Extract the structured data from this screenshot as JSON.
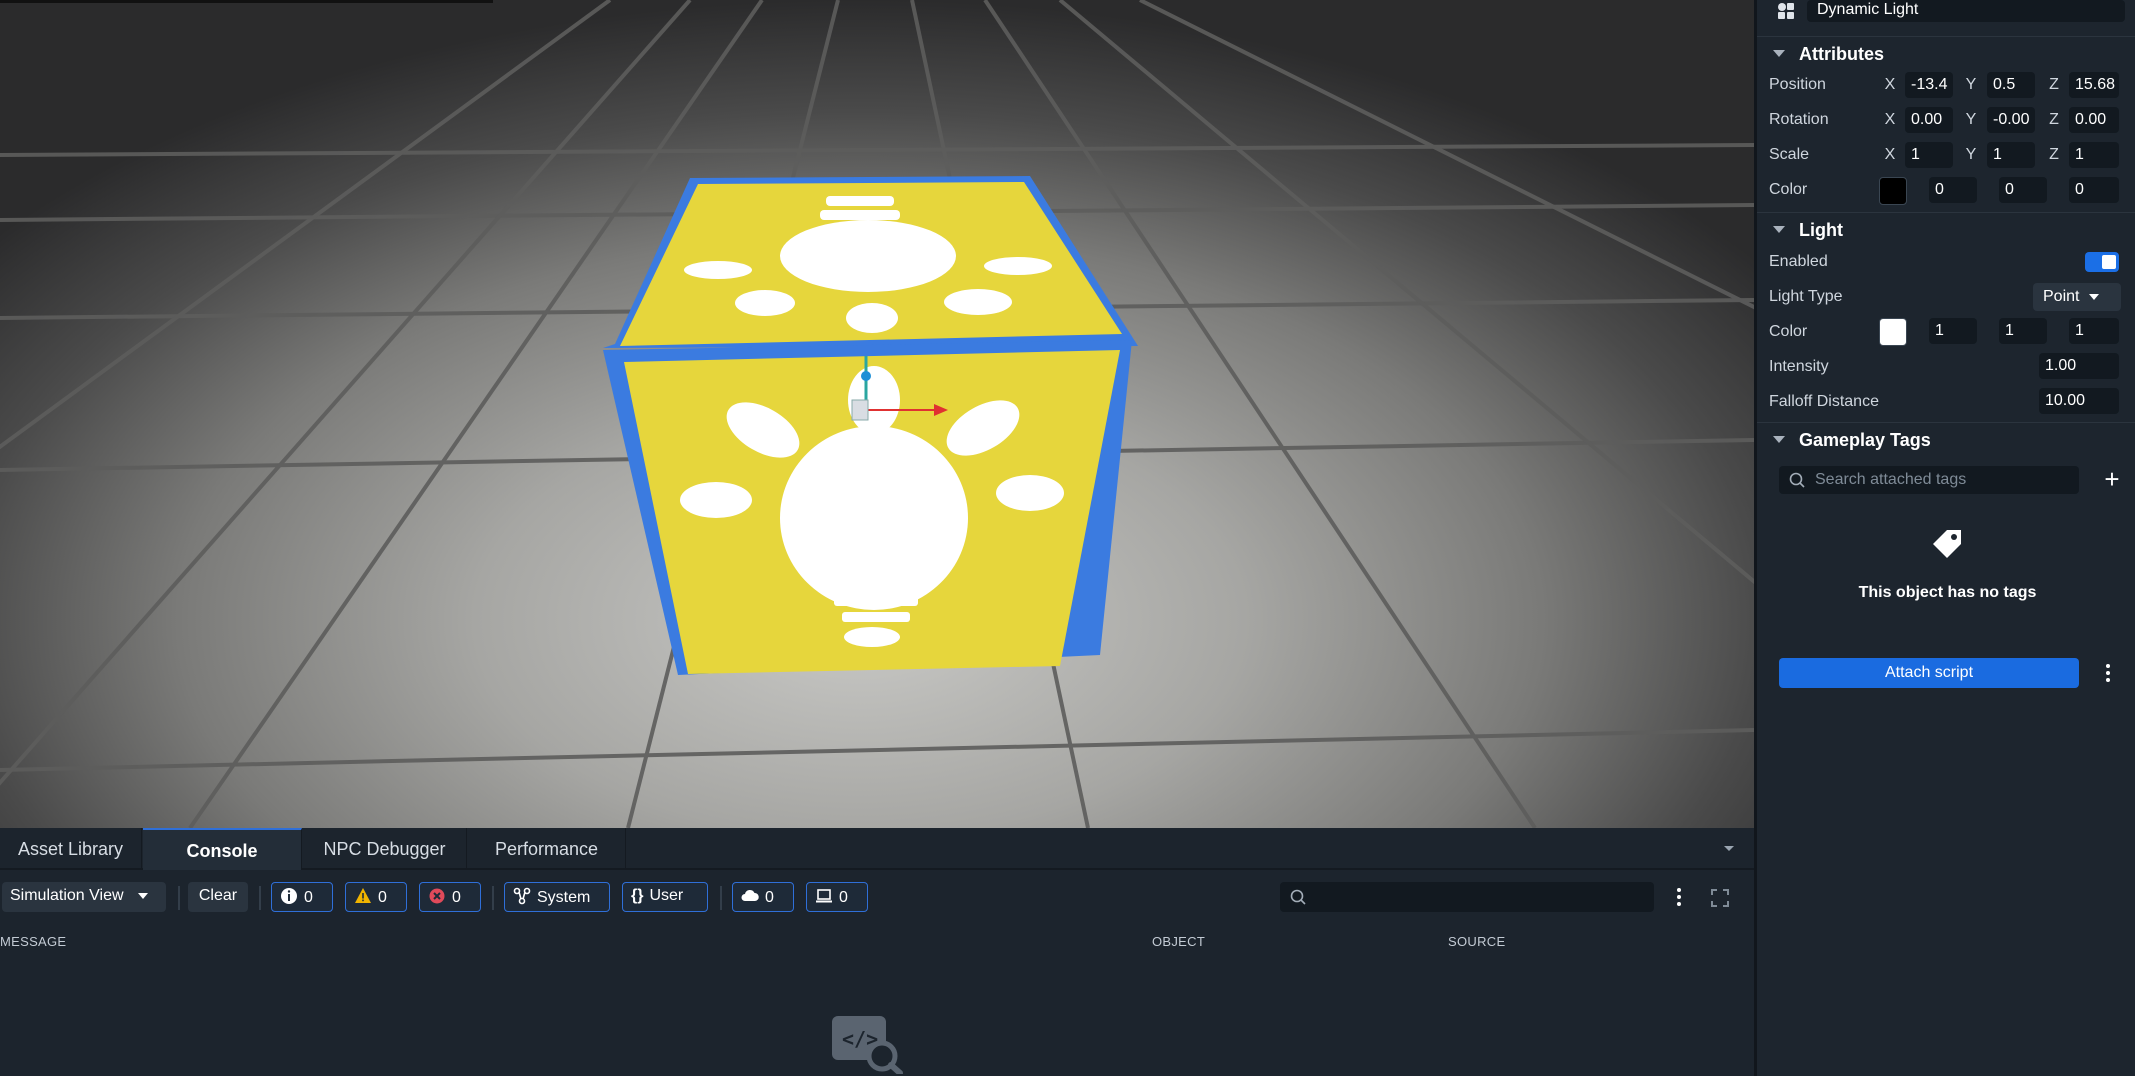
{
  "object": {
    "name": "Dynamic Light"
  },
  "attributes": {
    "title": "Attributes",
    "position": {
      "label": "Position",
      "x": "-13.4",
      "y": "0.5",
      "z": "15.68"
    },
    "rotation": {
      "label": "Rotation",
      "x": "0.00",
      "y": "-0.00",
      "z": "0.00"
    },
    "scale": {
      "label": "Scale",
      "x": "1",
      "y": "1",
      "z": "1"
    },
    "color": {
      "label": "Color",
      "swatch": "#000000",
      "r": "0",
      "g": "0",
      "b": "0"
    },
    "axes": {
      "x": "X",
      "y": "Y",
      "z": "Z"
    }
  },
  "light": {
    "title": "Light",
    "enabled_label": "Enabled",
    "enabled": true,
    "type_label": "Light Type",
    "type_value": "Point",
    "color_label": "Color",
    "color_swatch": "#ffffff",
    "r": "1",
    "g": "1",
    "b": "1",
    "intensity_label": "Intensity",
    "intensity": "1.00",
    "falloff_label": "Falloff Distance",
    "falloff": "10.00"
  },
  "tags": {
    "title": "Gameplay Tags",
    "search_placeholder": "Search attached tags",
    "add_symbol": "+",
    "empty_text": "This object has no tags"
  },
  "actions": {
    "attach_script": "Attach script"
  },
  "dock": {
    "tabs": [
      {
        "label": "Asset Library"
      },
      {
        "label": "Console",
        "active": true
      },
      {
        "label": "NPC Debugger"
      },
      {
        "label": "Performance"
      }
    ],
    "toolbar": {
      "view_select": "Simulation View",
      "clear": "Clear",
      "info_count": "0",
      "warning_count": "0",
      "error_count": "0",
      "system": "System",
      "user": "User",
      "cloud_count": "0",
      "device_count": "0"
    },
    "columns": {
      "message": "MESSAGE",
      "object": "OBJECT",
      "source": "SOURCE"
    }
  },
  "colors": {
    "accent": "#1a6be0",
    "cube": "#e6d63c",
    "selection": "#3b7be0"
  }
}
